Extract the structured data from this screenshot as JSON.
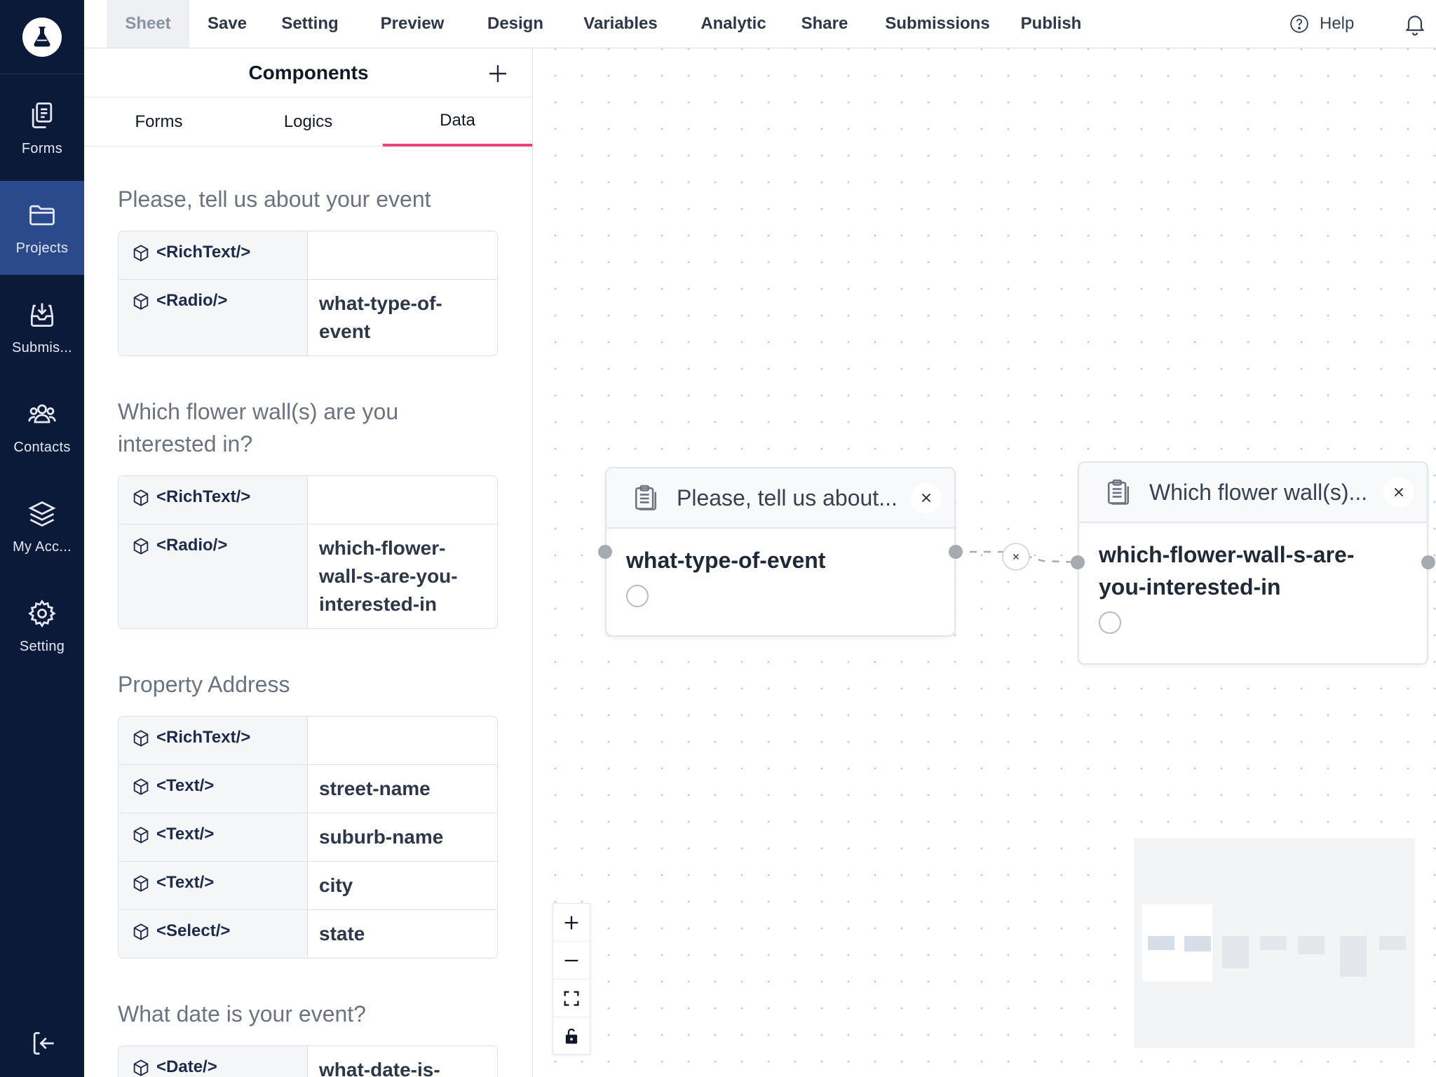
{
  "nav": {
    "items": [
      {
        "label": "Forms",
        "icon": "forms-icon"
      },
      {
        "label": "Projects",
        "icon": "folder-icon"
      },
      {
        "label": "Submis...",
        "icon": "inbox-icon"
      },
      {
        "label": "Contacts",
        "icon": "contacts-icon"
      },
      {
        "label": "My Acc...",
        "icon": "layers-icon"
      },
      {
        "label": "Setting",
        "icon": "gear-icon"
      }
    ],
    "active": "Projects",
    "colors": {
      "background": "#0c1a3a",
      "active": "#2b4a8c"
    }
  },
  "menubar": {
    "items": [
      "Sheet",
      "Save",
      "Setting",
      "Preview",
      "Design",
      "Variables",
      "Analytic",
      "Share",
      "Submissions",
      "Publish"
    ],
    "active": "Sheet",
    "help_label": "Help"
  },
  "panel": {
    "title": "Components",
    "tabs": [
      "Forms",
      "Logics",
      "Data"
    ],
    "active_tab": "Data",
    "accent_color": "#e8457c",
    "sections": [
      {
        "title": "Please, tell us about your event",
        "rows": [
          {
            "component": "<RichText/>",
            "value": ""
          },
          {
            "component": "<Radio/>",
            "value": "what-type-of-event"
          }
        ]
      },
      {
        "title": "Which flower wall(s) are you interested in?",
        "rows": [
          {
            "component": "<RichText/>",
            "value": ""
          },
          {
            "component": "<Radio/>",
            "value": "which-flower-wall-s-are-you-interested-in"
          }
        ]
      },
      {
        "title": "Property Address",
        "rows": [
          {
            "component": "<RichText/>",
            "value": ""
          },
          {
            "component": "<Text/>",
            "value": "street-name"
          },
          {
            "component": "<Text/>",
            "value": "suburb-name"
          },
          {
            "component": "<Text/>",
            "value": "city"
          },
          {
            "component": "<Select/>",
            "value": "state"
          }
        ]
      },
      {
        "title": "What date is your event?",
        "rows": [
          {
            "component": "<Date/>",
            "value": "what-date-is-"
          }
        ]
      }
    ]
  },
  "canvas": {
    "nodes": [
      {
        "title": "Please, tell us about...",
        "field": "what-type-of-event"
      },
      {
        "title": "Which flower wall(s)...",
        "field": "which-flower-wall-s-are-you-interested-in"
      }
    ]
  }
}
